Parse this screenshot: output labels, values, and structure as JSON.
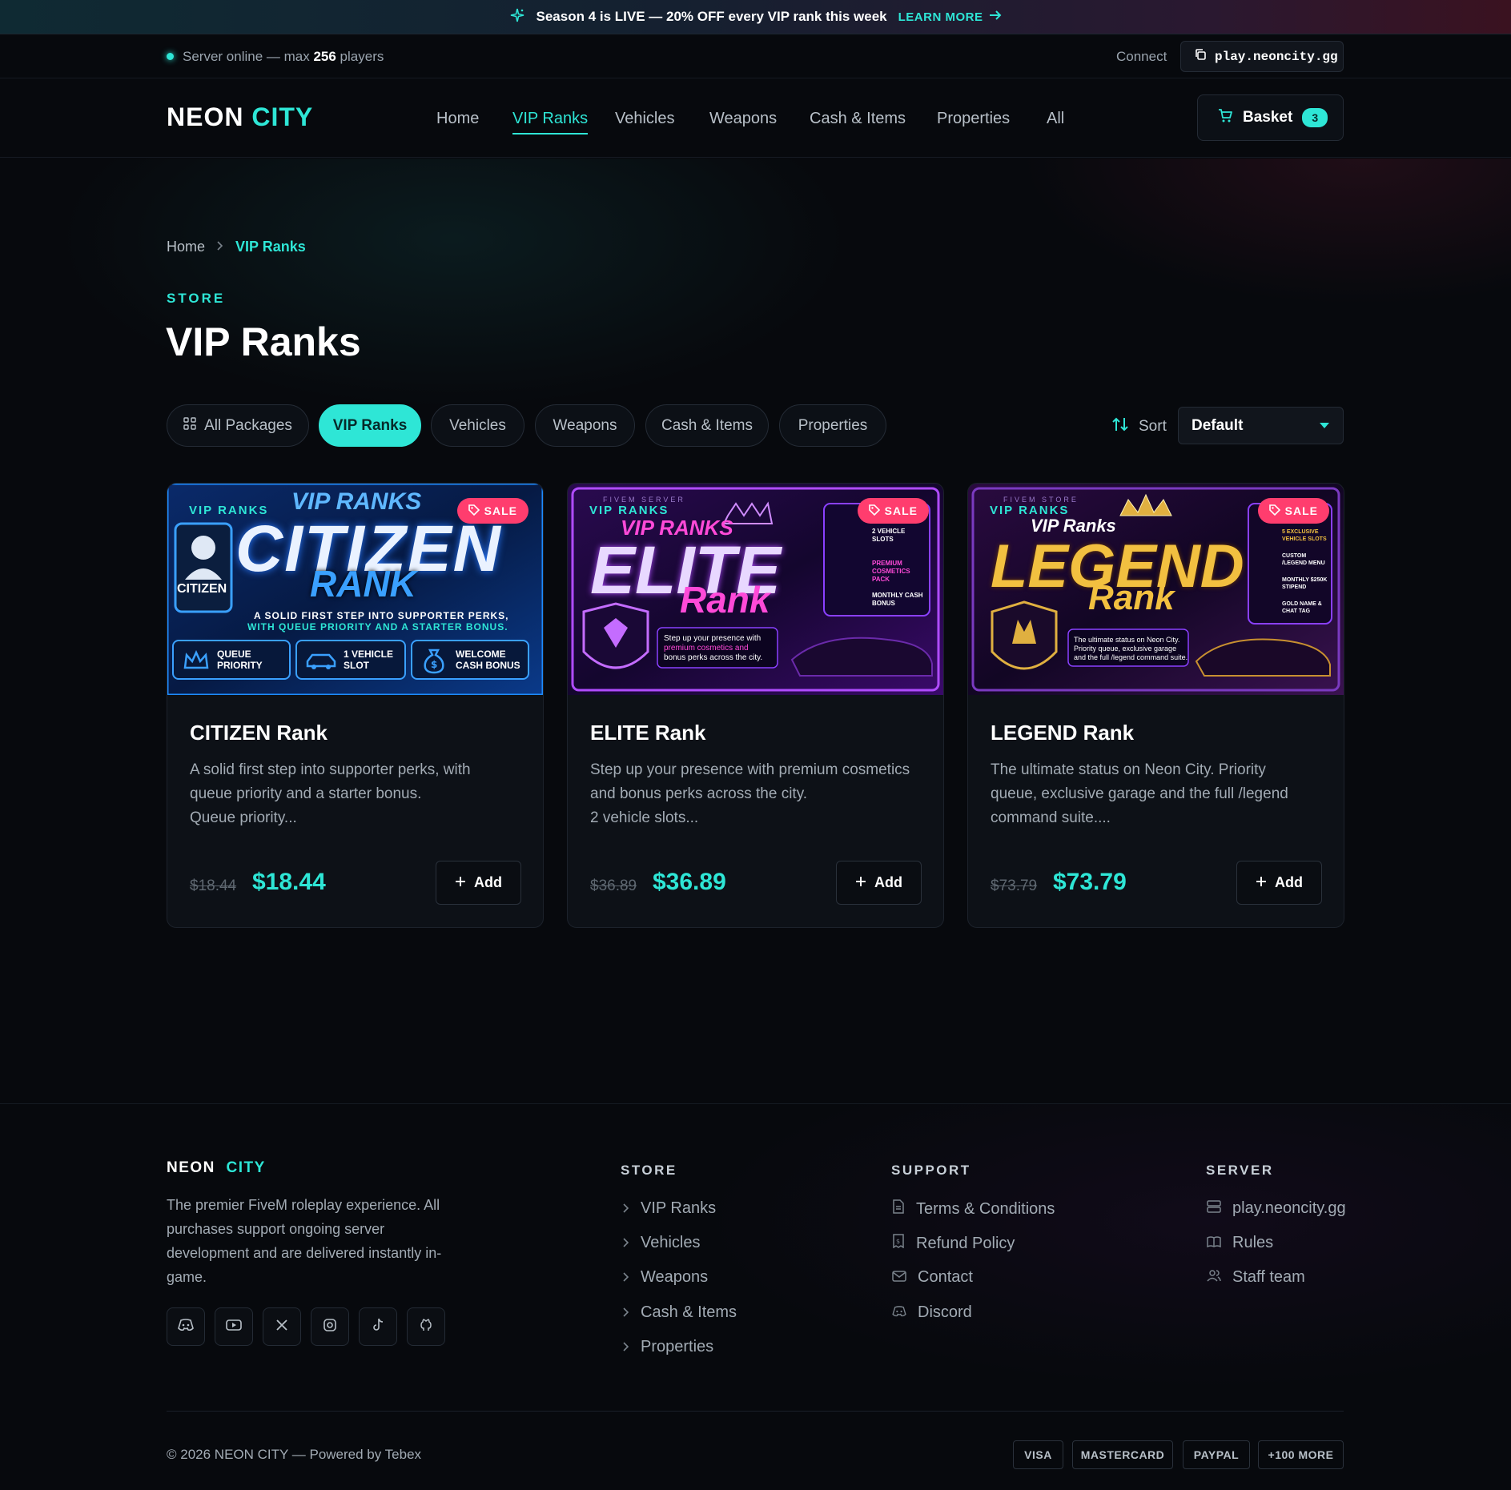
{
  "announcement": {
    "text": "Season 4 is LIVE — 20% OFF every VIP rank this week",
    "cta": "LEARN MORE"
  },
  "status": {
    "prefix": "Server online — max ",
    "players": "256",
    "suffix": " players",
    "connect_label": "Connect",
    "address": "play.neoncity.gg"
  },
  "brand": {
    "part1": "NEON",
    "part2": "CITY"
  },
  "nav": {
    "items": [
      "Home",
      "VIP Ranks",
      "Vehicles",
      "Weapons",
      "Cash & Items",
      "Properties",
      "All"
    ],
    "active": "VIP Ranks"
  },
  "basket": {
    "label": "Basket",
    "count": "3"
  },
  "breadcrumb": {
    "home": "Home",
    "current": "VIP Ranks"
  },
  "page": {
    "eyebrow": "STORE",
    "title": "VIP Ranks"
  },
  "filters": {
    "items": [
      "All Packages",
      "VIP Ranks",
      "Vehicles",
      "Weapons",
      "Cash & Items",
      "Properties"
    ],
    "active": "VIP Ranks",
    "sort_label": "Sort",
    "sort_value": "Default"
  },
  "products": [
    {
      "title": "CITIZEN Rank",
      "desc_line1": "A solid first step into supporter perks, with",
      "desc_line2": "queue priority and a starter bonus.",
      "desc_line3": "Queue priority...",
      "old_price": "$18.44",
      "price": "$18.44",
      "add_label": "Add",
      "sale_label": "SALE",
      "banner": {
        "tag": "VIP RANKS",
        "script": "VIP RANKS",
        "main": "CITIZEN",
        "sub": "RANK",
        "badge": "CITIZEN",
        "tagline1": "A SOLID FIRST STEP INTO SUPPORTER PERKS,",
        "tagline2": "WITH QUEUE PRIORITY AND A STARTER BONUS.",
        "perk1": "QUEUE PRIORITY",
        "perk2": "1 VEHICLE SLOT",
        "perk3": "WELCOME CASH BONUS"
      }
    },
    {
      "title": "ELITE Rank",
      "desc_line1": "Step up your presence with premium cosmetics",
      "desc_line2": "and bonus perks across the city.",
      "desc_line3": "2 vehicle slots...",
      "old_price": "$36.89",
      "price": "$36.89",
      "add_label": "Add",
      "sale_label": "SALE",
      "banner": {
        "tag": "VIP RANKS",
        "top": "FIVEM SERVER",
        "script": "VIP RANKS",
        "main": "ELITE",
        "sub": "Rank",
        "blurb1": "Step up your presence with",
        "blurb2": "premium cosmetics and",
        "blurb3": "bonus perks across the city.",
        "perk1": "2 VEHICLE SLOTS",
        "perk2": "PREMIUM COSMETICS PACK",
        "perk3": "MONTHLY CASH BONUS"
      }
    },
    {
      "title": "LEGEND Rank",
      "desc_line1": "The ultimate status on Neon City. Priority",
      "desc_line2": "queue, exclusive garage and the full /legend",
      "desc_line3": "command suite....",
      "old_price": "$73.79",
      "price": "$73.79",
      "add_label": "Add",
      "sale_label": "SALE",
      "banner": {
        "tag": "VIP RANKS",
        "top": "FIVEM STORE",
        "script": "VIP Ranks",
        "main": "LEGEND",
        "sub": "Rank",
        "blurb1": "The ultimate status on Neon City.",
        "blurb2": "Priority queue, exclusive garage",
        "blurb3": "and the full /legend command suite.",
        "perk1": "5 EXCLUSIVE VEHICLE SLOTS",
        "perk2": "CUSTOM /LEGEND MENU",
        "perk3": "MONTHLY $250K STIPEND",
        "perk4": "GOLD NAME & CHAT TAG"
      }
    }
  ],
  "footer": {
    "brand1": "NEON",
    "brand2": "CITY",
    "about1": "The premier FiveM roleplay experience. All",
    "about2": "purchases support ongoing server",
    "about3": "development and are delivered instantly in-",
    "about4": "game.",
    "store_head": "STORE",
    "store_links": [
      "VIP Ranks",
      "Vehicles",
      "Weapons",
      "Cash & Items",
      "Properties"
    ],
    "support_head": "SUPPORT",
    "support_links": [
      "Terms & Conditions",
      "Refund Policy",
      "Contact",
      "Discord"
    ],
    "server_head": "SERVER",
    "server_links": [
      "play.neoncity.gg",
      "Rules",
      "Staff team"
    ],
    "copyright": "© 2026 NEON CITY — Powered by Tebex",
    "payments": [
      "VISA",
      "MASTERCARD",
      "PAYPAL",
      "+100 MORE"
    ]
  },
  "colors": {
    "accent": "#2ee6d6",
    "sale": "#ff3d6e",
    "bg": "#07090d"
  }
}
